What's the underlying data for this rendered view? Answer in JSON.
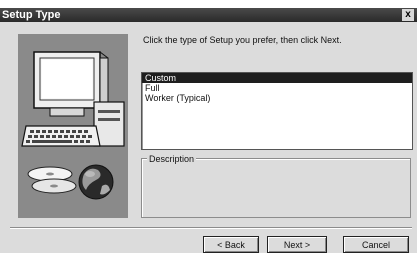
{
  "window": {
    "title": "Setup Type",
    "close_glyph": "x"
  },
  "main": {
    "prompt": "Click the type of Setup you prefer, then click Next.",
    "setup_types": [
      {
        "label": "Custom",
        "selected": true
      },
      {
        "label": "Full",
        "selected": false
      },
      {
        "label": "Worker (Typical)",
        "selected": false
      }
    ],
    "description_label": "Description"
  },
  "buttons": {
    "back": "< Back",
    "next": "Next >",
    "cancel": "Cancel"
  },
  "illustration": {
    "icons": [
      "computer-monitor-icon",
      "keyboard-icon",
      "cd-disc-icon",
      "globe-icon"
    ]
  },
  "colors": {
    "titlebar": "#333333",
    "selection": "#1e1e1e",
    "dialog_bg": "#dcdcdc"
  }
}
